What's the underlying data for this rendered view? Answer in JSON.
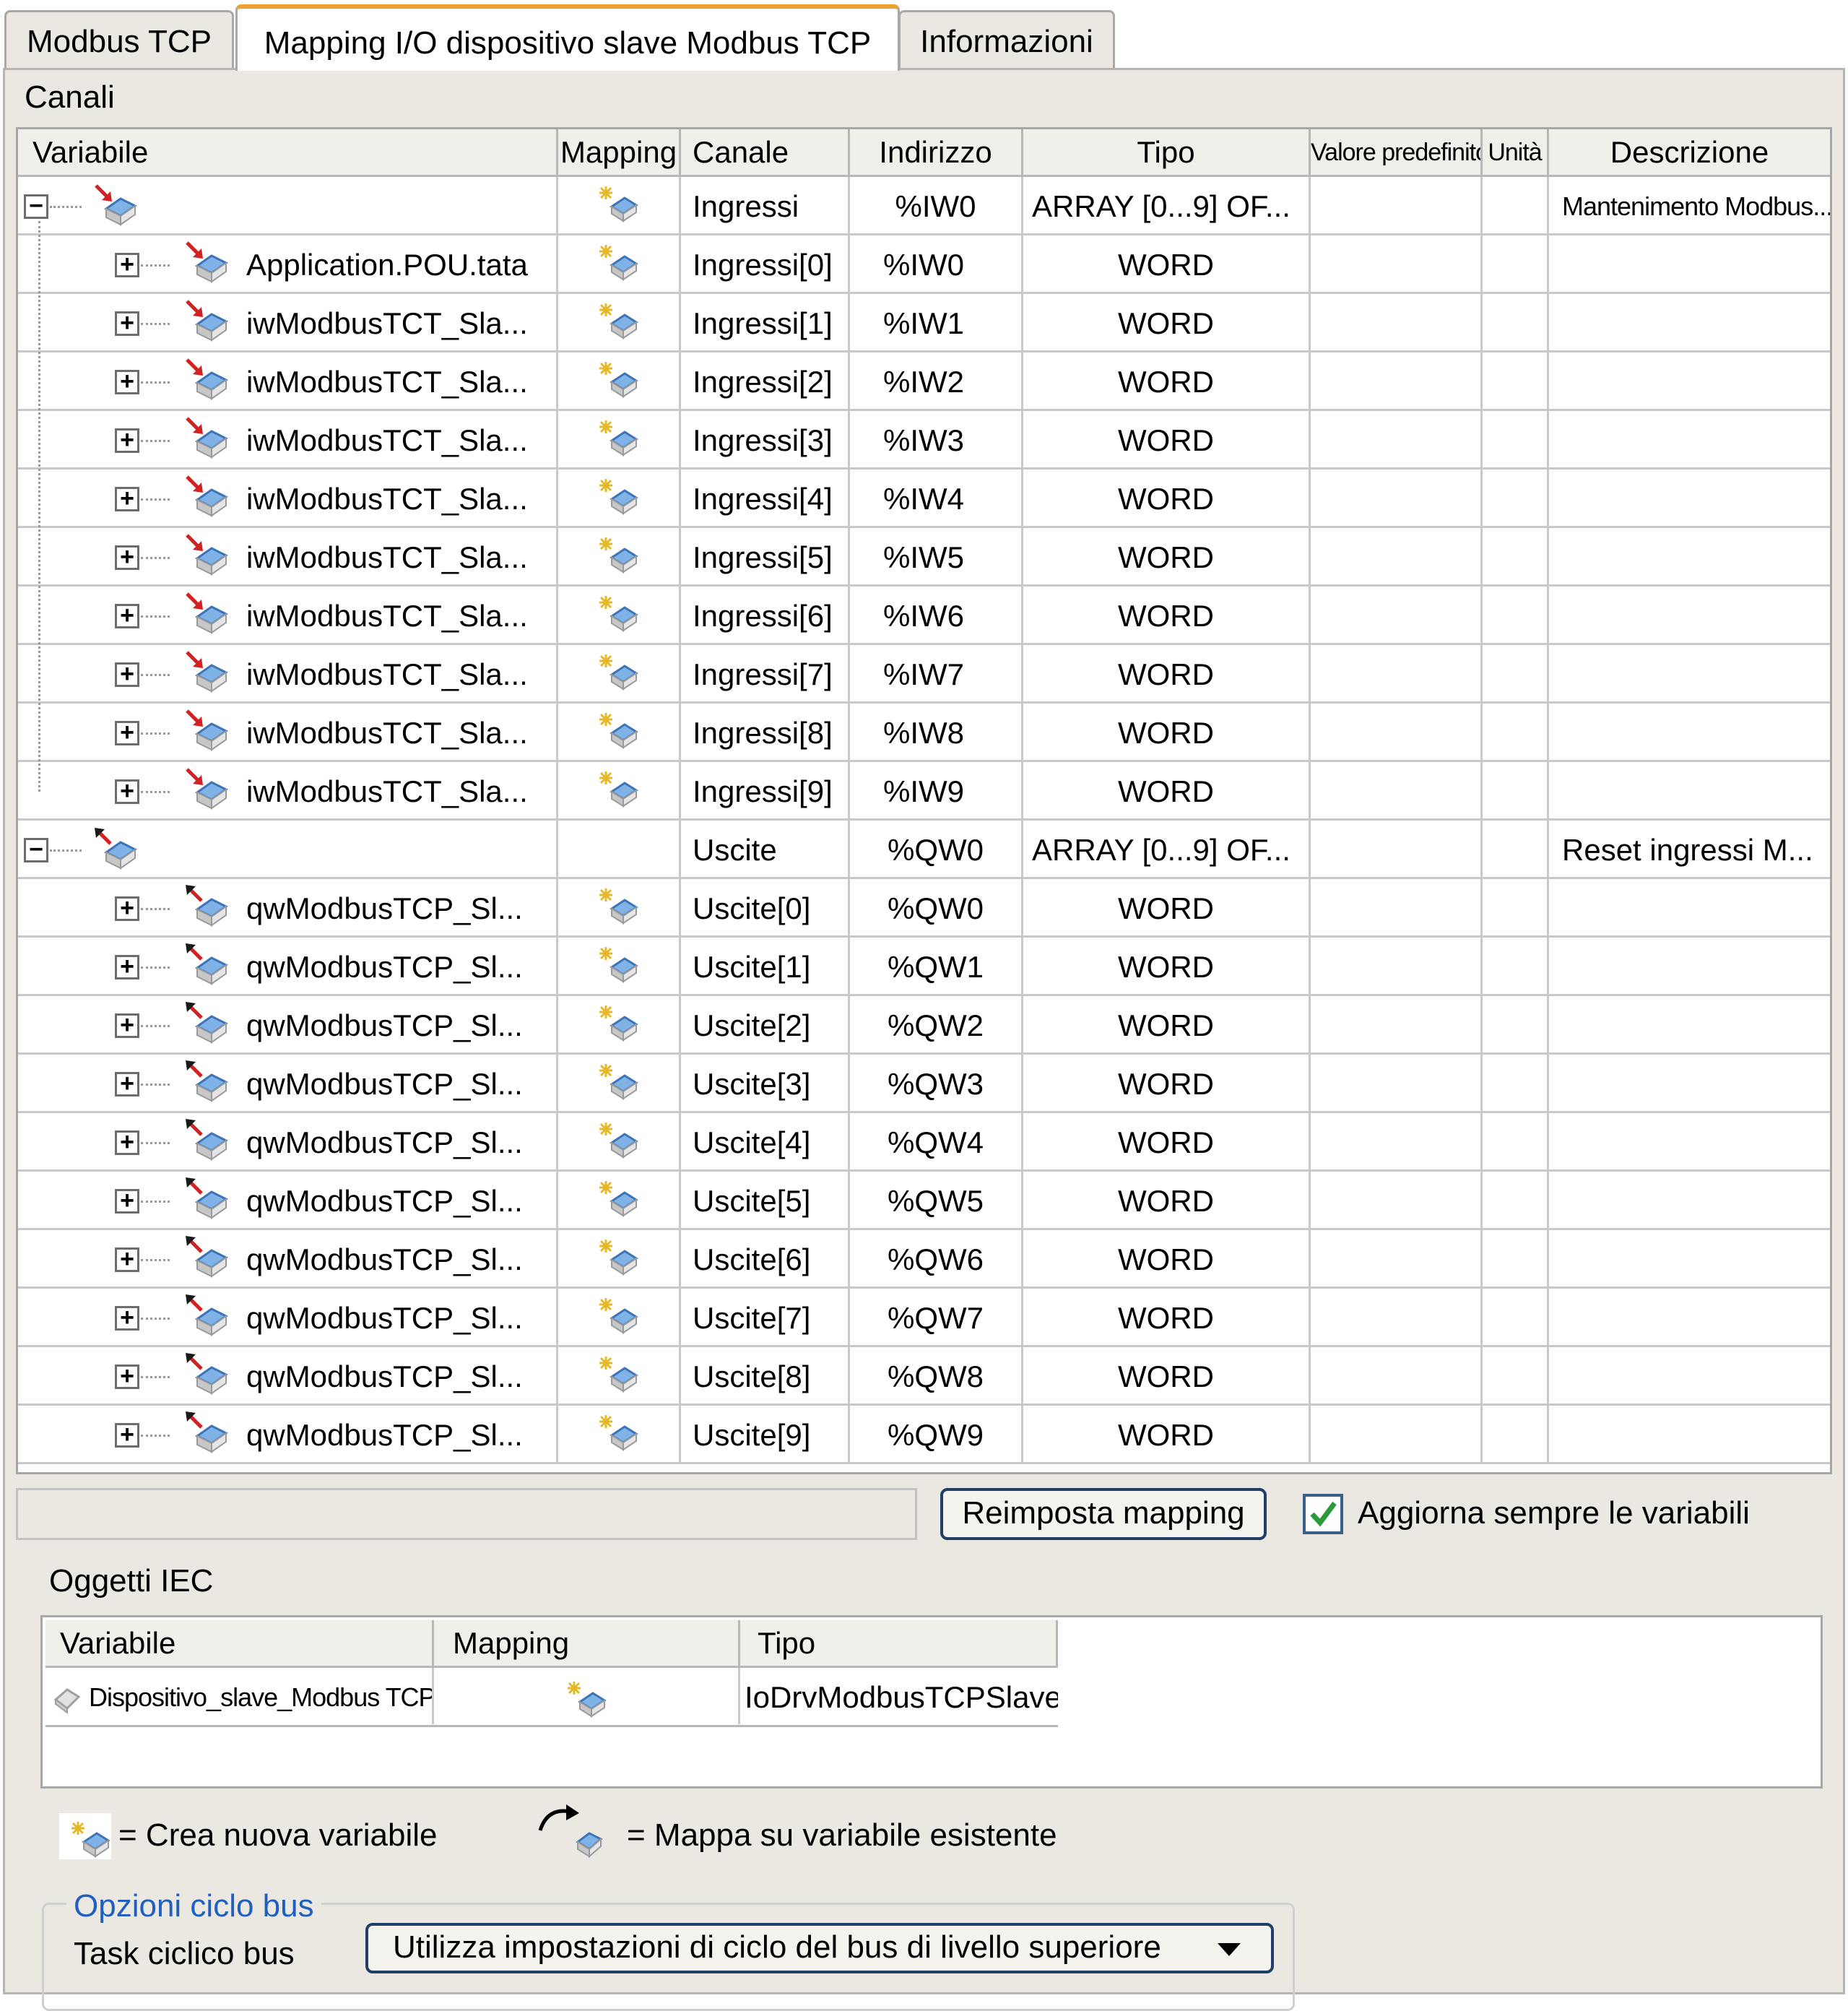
{
  "tabs": [
    {
      "label": "Modbus TCP",
      "active": false
    },
    {
      "label": "Mapping I/O dispositivo slave Modbus TCP",
      "active": true
    },
    {
      "label": "Informazioni",
      "active": false
    }
  ],
  "channels": {
    "section_label": "Canali",
    "columns": [
      "Variabile",
      "Mapping",
      "Canale",
      "Indirizzo",
      "Tipo",
      "Valore predefinito",
      "Unità",
      "Descrizione"
    ],
    "groups": [
      {
        "variable": "",
        "channel": "Ingressi",
        "address": "%IW0",
        "type": "ARRAY [0...9] OF...",
        "description": "Mantenimento Modbus...",
        "direction": "input",
        "rows": [
          {
            "variable": "Application.POU.tata",
            "channel": "Ingressi[0]",
            "address": "%IW0",
            "type": "WORD"
          },
          {
            "variable": "iwModbusTCT_Sla...",
            "channel": "Ingressi[1]",
            "address": "%IW1",
            "type": "WORD"
          },
          {
            "variable": "iwModbusTCT_Sla...",
            "channel": "Ingressi[2]",
            "address": "%IW2",
            "type": "WORD"
          },
          {
            "variable": "iwModbusTCT_Sla...",
            "channel": "Ingressi[3]",
            "address": "%IW3",
            "type": "WORD"
          },
          {
            "variable": "iwModbusTCT_Sla...",
            "channel": "Ingressi[4]",
            "address": "%IW4",
            "type": "WORD"
          },
          {
            "variable": "iwModbusTCT_Sla...",
            "channel": "Ingressi[5]",
            "address": "%IW5",
            "type": "WORD"
          },
          {
            "variable": "iwModbusTCT_Sla...",
            "channel": "Ingressi[6]",
            "address": "%IW6",
            "type": "WORD"
          },
          {
            "variable": "iwModbusTCT_Sla...",
            "channel": "Ingressi[7]",
            "address": "%IW7",
            "type": "WORD"
          },
          {
            "variable": "iwModbusTCT_Sla...",
            "channel": "Ingressi[8]",
            "address": "%IW8",
            "type": "WORD"
          },
          {
            "variable": "iwModbusTCT_Sla...",
            "channel": "Ingressi[9]",
            "address": "%IW9",
            "type": "WORD"
          }
        ]
      },
      {
        "variable": "",
        "channel": "Uscite",
        "address": "%QW0",
        "type": "ARRAY [0...9] OF...",
        "description": "Reset ingressi M...",
        "direction": "output",
        "rows": [
          {
            "variable": "qwModbusTCP_Sl...",
            "channel": "Uscite[0]",
            "address": "%QW0",
            "type": "WORD"
          },
          {
            "variable": "qwModbusTCP_Sl...",
            "channel": "Uscite[1]",
            "address": "%QW1",
            "type": "WORD"
          },
          {
            "variable": "qwModbusTCP_Sl...",
            "channel": "Uscite[2]",
            "address": "%QW2",
            "type": "WORD"
          },
          {
            "variable": "qwModbusTCP_Sl...",
            "channel": "Uscite[3]",
            "address": "%QW3",
            "type": "WORD"
          },
          {
            "variable": "qwModbusTCP_Sl...",
            "channel": "Uscite[4]",
            "address": "%QW4",
            "type": "WORD"
          },
          {
            "variable": "qwModbusTCP_Sl...",
            "channel": "Uscite[5]",
            "address": "%QW5",
            "type": "WORD"
          },
          {
            "variable": "qwModbusTCP_Sl...",
            "channel": "Uscite[6]",
            "address": "%QW6",
            "type": "WORD"
          },
          {
            "variable": "qwModbusTCP_Sl...",
            "channel": "Uscite[7]",
            "address": "%QW7",
            "type": "WORD"
          },
          {
            "variable": "qwModbusTCP_Sl...",
            "channel": "Uscite[8]",
            "address": "%QW8",
            "type": "WORD"
          },
          {
            "variable": "qwModbusTCP_Sl...",
            "channel": "Uscite[9]",
            "address": "%QW9",
            "type": "WORD"
          }
        ]
      }
    ]
  },
  "toolbar": {
    "filter_value": "",
    "reset_button": "Reimposta mapping",
    "always_update_label": "Aggiorna sempre le variabili",
    "always_update_checked": true
  },
  "iec": {
    "section_label": "Oggetti IEC",
    "columns": [
      "Variabile",
      "Mapping",
      "Tipo"
    ],
    "rows": [
      {
        "variable": "Dispositivo_slave_Modbus TCP",
        "type": "IoDrvModbusTCPSlave"
      }
    ]
  },
  "legend": {
    "new_variable": "= Crea nuova variabile",
    "existing_variable": "= Mappa su variabile esistente"
  },
  "bus_cycle": {
    "group_label": "Opzioni ciclo bus",
    "task_label": "Task ciclico bus",
    "task_value": "Utilizza impostazioni di ciclo del bus di livello superiore"
  },
  "colors": {
    "panel_bg": "#ebe8e1",
    "active_tab_accent": "#f0a030",
    "link_blue": "#1f5fc0",
    "check_green": "#2a9a3a"
  }
}
